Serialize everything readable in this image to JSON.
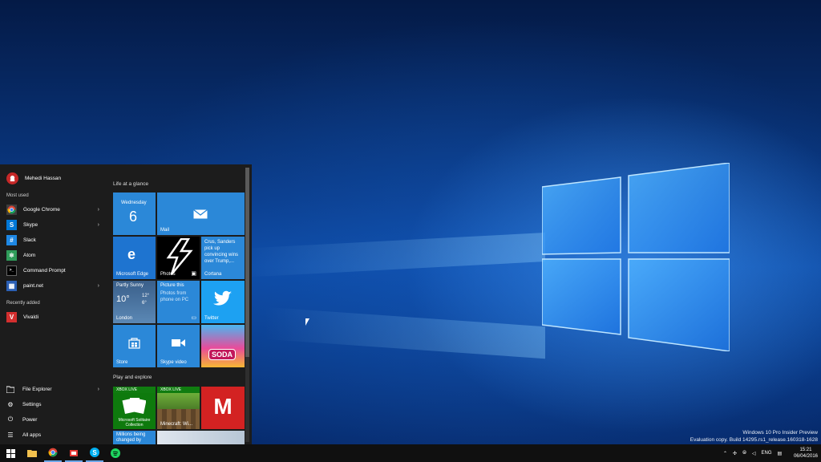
{
  "watermark": {
    "line1": "Windows 10 Pro Insider Preview",
    "line2": "Evaluation copy. Build 14295.rs1_release.160318-1628"
  },
  "start_menu": {
    "user": "Mehedi Hassan",
    "most_used_label": "Most used",
    "most_used": [
      {
        "label": "Google Chrome",
        "icon": "chrome-icon",
        "color": "#3d3d3d",
        "glyph": "◉",
        "arrow": "›"
      },
      {
        "label": "Skype",
        "icon": "skype-icon",
        "color": "#0078d7",
        "glyph": "S",
        "arrow": "›"
      },
      {
        "label": "Slack",
        "icon": "slack-icon",
        "color": "#1e88e5",
        "glyph": "#",
        "arrow": ""
      },
      {
        "label": "Atom",
        "icon": "atom-icon",
        "color": "#2f9c5a",
        "glyph": "⚛",
        "arrow": ""
      },
      {
        "label": "Command Prompt",
        "icon": "command-prompt-icon",
        "color": "#000000",
        "glyph": ">_",
        "arrow": ""
      },
      {
        "label": "paint.net",
        "icon": "paintnet-icon",
        "color": "#2b5fb4",
        "glyph": "▦",
        "arrow": "›"
      }
    ],
    "recently_added_label": "Recently added",
    "recently_added": [
      {
        "label": "Vivaldi",
        "icon": "vivaldi-icon",
        "color": "#d32f2f",
        "glyph": "V"
      }
    ],
    "system": {
      "file_explorer": "File Explorer",
      "settings": "Settings",
      "power": "Power",
      "all_apps": "All apps",
      "arrow": "›"
    },
    "groups": {
      "life": "Life at a glance",
      "play": "Play and explore"
    },
    "tiles": {
      "calendar_day": "Wednesday",
      "calendar_date": "6",
      "mail": "Mail",
      "edge": "Microsoft Edge",
      "photos": "Photos",
      "cortana_text": "Crus, Sanders pick up convincing wins over Trump,...",
      "cortana": "Cortana",
      "weather_cond": "Partly Sunny",
      "weather_temp": "10°",
      "weather_hi": "12°",
      "weather_lo": "6°",
      "weather_city": "London",
      "phone_text": "Picture this",
      "phone_sub": "Photos from phone on PC",
      "twitter": "Twitter",
      "store": "Store",
      "skype_video": "Skype video",
      "candy": "SODA",
      "xbox_live": "XBOX LIVE",
      "solitaire": "Microsoft Solitaire Collection",
      "minecraft": "Minecraft: Wi...",
      "m_tile": "M",
      "news_text": "Millions being changed by"
    }
  },
  "taskbar": {
    "lang": "ENG",
    "time": "15:21",
    "date": "06/04/2016"
  },
  "colors": {
    "tile_blue": "#2b88d8",
    "start_bg": "#1c1c1c",
    "taskbar_bg": "#101010"
  }
}
